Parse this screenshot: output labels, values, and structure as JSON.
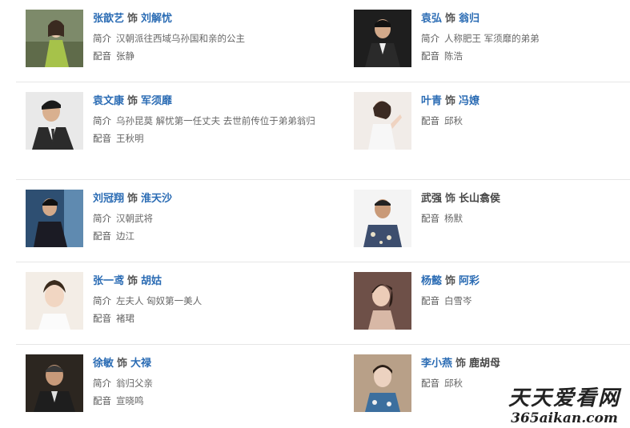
{
  "cast": [
    {
      "left": {
        "actor": "张歆艺",
        "shi": "饰",
        "role": "刘解忧",
        "intro_label": "简介",
        "intro": "汉朝派往西域乌孙国和亲的公主",
        "dub_label": "配音",
        "dub": "张静"
      },
      "right": {
        "actor": "袁弘",
        "shi": "饰",
        "role": "翁归",
        "intro_label": "简介",
        "intro": "人称肥王 军须靡的弟弟",
        "dub_label": "配音",
        "dub": "陈浩"
      }
    },
    {
      "left": {
        "actor": "袁文康",
        "shi": "饰",
        "role": "军须靡",
        "intro_label": "简介",
        "intro": "乌孙昆莫 解忧第一任丈夫 去世前传位于弟弟翁归",
        "dub_label": "配音",
        "dub": "王秋明"
      },
      "right": {
        "actor": "叶青",
        "shi": "饰",
        "role": "冯嫽",
        "dub_label": "配音",
        "dub": "邱秋"
      }
    },
    {
      "left": {
        "actor": "刘冠翔",
        "shi": "饰",
        "role": "淮天沙",
        "intro_label": "简介",
        "intro": "汉朝武将",
        "dub_label": "配音",
        "dub": "边江"
      },
      "right": {
        "actor": "武强",
        "shi": "饰",
        "role": "长山翕侯",
        "dub_label": "配音",
        "dub": "杨默"
      }
    },
    {
      "left": {
        "actor": "张一鸢",
        "shi": "饰",
        "role": "胡姑",
        "intro_label": "简介",
        "intro": "左夫人 匈奴第一美人",
        "dub_label": "配音",
        "dub": "褚珺"
      },
      "right": {
        "actor": "杨懿",
        "shi": "饰",
        "role": "阿彩",
        "dub_label": "配音",
        "dub": "白雪岑"
      }
    },
    {
      "left": {
        "actor": "徐敏",
        "shi": "饰",
        "role": "大禄",
        "intro_label": "简介",
        "intro": "翁归父亲",
        "dub_label": "配音",
        "dub": "宣晓鸣"
      },
      "right": {
        "actor": "李小燕",
        "shi": "饰",
        "role": "鹿胡母",
        "dub_label": "配音",
        "dub": "邱秋"
      }
    }
  ],
  "watermark": {
    "text": "天天爱看网",
    "url": "365aikan.com"
  }
}
